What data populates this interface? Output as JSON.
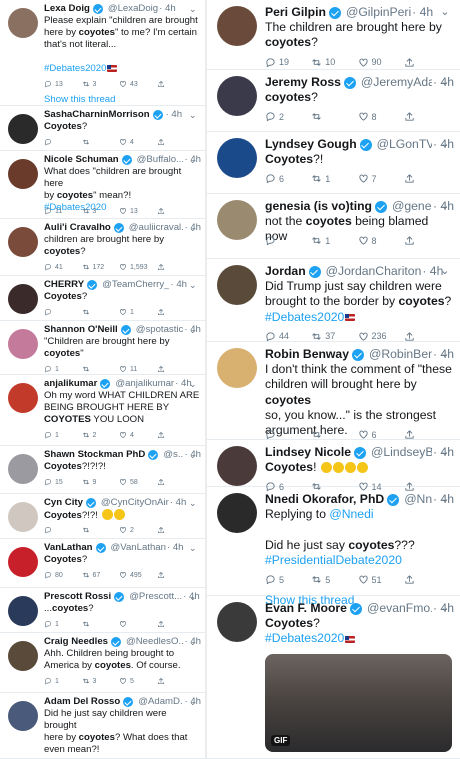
{
  "left": [
    {
      "name": "Lexa Doig",
      "verified": true,
      "handle": "@LexaDoig",
      "time": "· 4h",
      "avatar_color": "#8a7060",
      "lines": [
        [
          "Please explain \"children are brought"
        ],
        [
          "here by ",
          {
            "b": "coyotes"
          },
          "\" to me?  I'm certain"
        ],
        [
          "that's not literal..."
        ],
        [],
        [
          {
            "l": "#Debates2020"
          },
          {
            "flag": true
          }
        ]
      ],
      "stats": {
        "reply": "13",
        "retweet": "3",
        "like": "43"
      },
      "show_thread": "Show this thread"
    },
    {
      "name": "SashaCharninMorrison",
      "verified": true,
      "handle": "",
      "time": "· 4h",
      "avatar_color": "#2a2a2a",
      "lines": [
        [
          {
            "b": "Coyotes"
          },
          "?"
        ]
      ],
      "stats": {
        "reply": "",
        "retweet": "",
        "like": "4"
      }
    },
    {
      "name": "Nicole Schuman",
      "verified": true,
      "handle": "@Buffalo...",
      "time": "· 4h",
      "avatar_color": "#6a3a2a",
      "lines": [
        [
          "What does \"children are brought here"
        ],
        [
          "by ",
          {
            "b": "coyotes"
          },
          "\" mean?!"
        ],
        [
          {
            "l": "#Debates2020"
          }
        ]
      ],
      "stats": {
        "reply": "11",
        "retweet": "3",
        "like": "13"
      }
    },
    {
      "name": "Auli'i Cravalho",
      "verified": true,
      "handle": "@auliicraval...",
      "time": "· 4h",
      "avatar_color": "#7a4a3a",
      "lines": [
        [
          "children are brought here by"
        ],
        [
          {
            "b": "coyotes"
          },
          "?"
        ]
      ],
      "stats": {
        "reply": "41",
        "retweet": "172",
        "like": "1,593"
      }
    },
    {
      "name": "CHERRY",
      "verified": true,
      "handle": "@TeamCherry_",
      "time": "· 4h",
      "avatar_color": "#3a2a2a",
      "lines": [
        [
          {
            "b": "Coyotes"
          },
          "?"
        ]
      ],
      "stats": {
        "reply": "",
        "retweet": "",
        "like": "1"
      }
    },
    {
      "name": "Shannon O'Neill",
      "verified": true,
      "handle": "@spotastic",
      "time": "· 4h",
      "avatar_color": "#c47a9a",
      "lines": [
        [
          "\"Children are brought here by"
        ],
        [
          {
            "b": "coyotes"
          },
          "\""
        ]
      ],
      "stats": {
        "reply": "1",
        "retweet": "",
        "like": "11"
      }
    },
    {
      "name": "anjalikumar",
      "verified": true,
      "handle": "@anjalikumar",
      "time": "· 4h",
      "avatar_color": "#c23a2a",
      "lines": [
        [
          "Oh my word WHAT CHILDREN ARE"
        ],
        [
          "BEING BROUGHT HERE BY"
        ],
        [
          {
            "b": "COYOTES"
          },
          " YOU LOON"
        ]
      ],
      "stats": {
        "reply": "1",
        "retweet": "2",
        "like": "4"
      }
    },
    {
      "name": "Shawn Stockman PhD",
      "verified": true,
      "handle": "@s...",
      "time": "· 4h",
      "avatar_color": "#9a9aa0",
      "lines": [
        [
          {
            "b": "Coyotes"
          },
          "?!?!?!"
        ]
      ],
      "stats": {
        "reply": "15",
        "retweet": "9",
        "like": "58"
      }
    },
    {
      "name": "Cyn City",
      "verified": true,
      "handle": "@CynCityOnAir",
      "time": "· 4h",
      "avatar_color": "#d0c8c0",
      "lines": [
        [
          {
            "b": "Coyotes"
          },
          "?!?! ",
          {
            "emoji": 2
          }
        ]
      ],
      "stats": {
        "reply": "",
        "retweet": "",
        "like": "2"
      }
    },
    {
      "name": "VanLathan",
      "verified": true,
      "handle": "@VanLathan",
      "time": "· 4h",
      "avatar_color": "#c8202a",
      "lines": [
        [
          {
            "b": "Coyotes"
          },
          "?"
        ]
      ],
      "stats": {
        "reply": "80",
        "retweet": "67",
        "like": "495"
      }
    },
    {
      "name": "Prescott Rossi",
      "verified": true,
      "handle": "@Prescott...",
      "time": "· 4h",
      "avatar_color": "#2a3a5a",
      "lines": [
        [
          "...",
          {
            "b": "coyotes"
          },
          "?"
        ]
      ],
      "stats": {
        "reply": "1",
        "retweet": "",
        "like": ""
      }
    },
    {
      "name": "Craig Needles",
      "verified": true,
      "handle": "@NeedlesO...",
      "time": "· 4h",
      "avatar_color": "#5a4a3a",
      "lines": [
        [
          "Ahh. Children being brought to"
        ],
        [
          "America by ",
          {
            "b": "coyotes"
          },
          ". Of course."
        ]
      ],
      "stats": {
        "reply": "1",
        "retweet": "3",
        "like": "5"
      }
    },
    {
      "name": "Adam Del Rosso",
      "verified": true,
      "handle": "@AdamD...",
      "time": "· 4h",
      "avatar_color": "#4a5a7a",
      "lines": [
        [
          "Did he just say children were brought"
        ],
        [
          "here by ",
          {
            "b": "coyotes"
          },
          "? What does that"
        ],
        [
          "even mean?!"
        ]
      ],
      "stats": null
    }
  ],
  "right": [
    {
      "name": "Peri Gilpin",
      "verified": true,
      "handle": "@GilpinPeri",
      "time": "· 4h",
      "avatar_color": "#6a4a3a",
      "lines": [
        [
          "The children are brought here by"
        ],
        [
          {
            "b": "coyotes"
          },
          "?"
        ]
      ],
      "stats": {
        "reply": "19",
        "retweet": "10",
        "like": "90"
      }
    },
    {
      "name": "Jeremy Ross",
      "verified": true,
      "handle": "@JeremyAda...",
      "time": "· 4h",
      "avatar_color": "#3a3a4a",
      "lines": [
        [
          {
            "b": "coyotes"
          },
          "?"
        ]
      ],
      "stats": {
        "reply": "2",
        "retweet": "",
        "like": "8"
      }
    },
    {
      "name": "Lyndsey Gough",
      "verified": true,
      "handle": "@LGonTV",
      "time": "· 4h",
      "avatar_color": "#1a4a8a",
      "lines": [
        [
          {
            "b": "Coyotes"
          },
          "?!"
        ]
      ],
      "stats": {
        "reply": "6",
        "retweet": "1",
        "like": "7"
      }
    },
    {
      "name": "genesia (is vo)ting",
      "verified": true,
      "handle": "@gene...",
      "time": "· 4h",
      "avatar_color": "#9a8a70",
      "lines": [
        [
          "not the ",
          {
            "b": "coyotes"
          },
          " being blamed now"
        ]
      ],
      "stats": {
        "reply": "",
        "retweet": "1",
        "like": "8"
      }
    },
    {
      "name": "Jordan",
      "verified": true,
      "handle": "@JordanChariton",
      "time": "· 4h",
      "avatar_color": "#5a4a3a",
      "lines": [
        [
          "Did Trump just say children were"
        ],
        [
          "brought to the border by ",
          {
            "b": "coyotes"
          },
          "?"
        ],
        [
          {
            "l": "#Debates2020"
          },
          {
            "flag": true
          }
        ]
      ],
      "stats": {
        "reply": "44",
        "retweet": "37",
        "like": "236"
      }
    },
    {
      "name": "Robin Benway",
      "verified": true,
      "handle": "@RobinBen...",
      "time": "· 4h",
      "avatar_color": "#d8b070",
      "lines": [
        [
          "I don't think the comment of \"these"
        ],
        [
          "children will brought here by ",
          {
            "b": "coyotes"
          }
        ],
        [
          "so, you know...\" is the strongest"
        ],
        [
          "argument here."
        ]
      ],
      "stats": {
        "reply": "",
        "retweet": "",
        "like": "6"
      }
    },
    {
      "name": "Lindsey Nicole",
      "verified": true,
      "handle": "@LindseyB...",
      "time": "· 4h",
      "avatar_color": "#4a3a3a",
      "lines": [
        [
          {
            "b": "Coyotes"
          },
          "! ",
          {
            "emoji": 4
          }
        ]
      ],
      "stats": {
        "reply": "6",
        "retweet": "",
        "like": "14"
      }
    },
    {
      "name": "Nnedi Okorafor, PhD",
      "verified": true,
      "handle": "@Nn...",
      "time": "· 4h",
      "avatar_color": "#2a2a2a",
      "lines": [
        [
          "Replying to ",
          {
            "l": "@Nnedi"
          }
        ],
        [],
        [
          "Did he just say ",
          {
            "b": "coyotes"
          },
          "???"
        ],
        [
          {
            "l": "#PresidentialDebate2020"
          }
        ]
      ],
      "stats": {
        "reply": "5",
        "retweet": "5",
        "like": "51"
      },
      "show_thread": "Show this thread"
    },
    {
      "name": "Evan F. Moore",
      "verified": true,
      "handle": "@evanFmo...",
      "time": "· 4h",
      "avatar_color": "#3a3a3a",
      "lines": [
        [
          {
            "b": "Coyotes"
          },
          "?"
        ],
        [
          {
            "l": "#Debates2020"
          },
          {
            "flag": true
          }
        ]
      ],
      "stats": null,
      "gif_label": "GIF"
    }
  ]
}
